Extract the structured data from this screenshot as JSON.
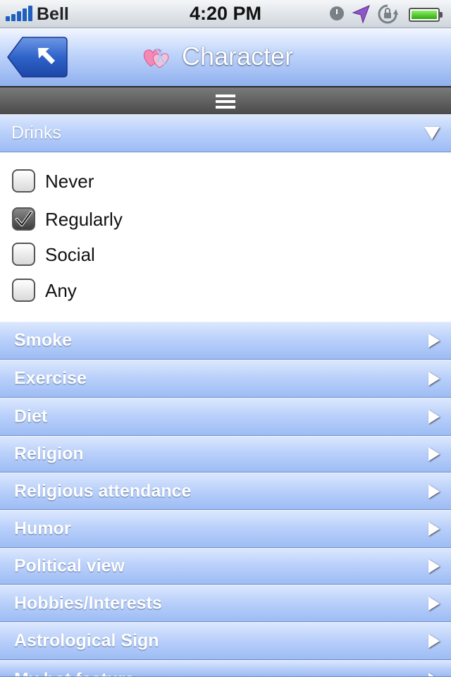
{
  "status_bar": {
    "carrier": "Bell",
    "time": "4:20 PM",
    "icons": [
      "signal-icon",
      "alarm-icon",
      "location-icon",
      "rotation-lock-icon",
      "battery-icon"
    ]
  },
  "nav": {
    "title": "Character",
    "back_icon": "back-arrow-icon",
    "logo_icon": "hearts-logo-icon"
  },
  "menu": {
    "icon": "menu-lines-icon"
  },
  "expanded_section": {
    "label": "Drinks",
    "options": [
      {
        "label": "Never",
        "checked": false
      },
      {
        "label": "Regularly",
        "checked": true
      },
      {
        "label": "Social",
        "checked": false
      },
      {
        "label": "Any",
        "checked": false
      }
    ]
  },
  "sections": [
    {
      "label": "Smoke"
    },
    {
      "label": "Exercise"
    },
    {
      "label": "Diet"
    },
    {
      "label": "Religion"
    },
    {
      "label": "Religious attendance"
    },
    {
      "label": "Humor"
    },
    {
      "label": "Political view"
    },
    {
      "label": "Hobbies/Interests"
    },
    {
      "label": "Astrological Sign"
    },
    {
      "label": "My hot feature"
    }
  ],
  "colors": {
    "nav_gradient_top": "#f2f6ff",
    "nav_gradient_bottom": "#8fb0ee",
    "section_blue": "#b8cffa",
    "back_button_blue": "#2a56b8",
    "checkbox_checked": "#3c3c3c"
  }
}
